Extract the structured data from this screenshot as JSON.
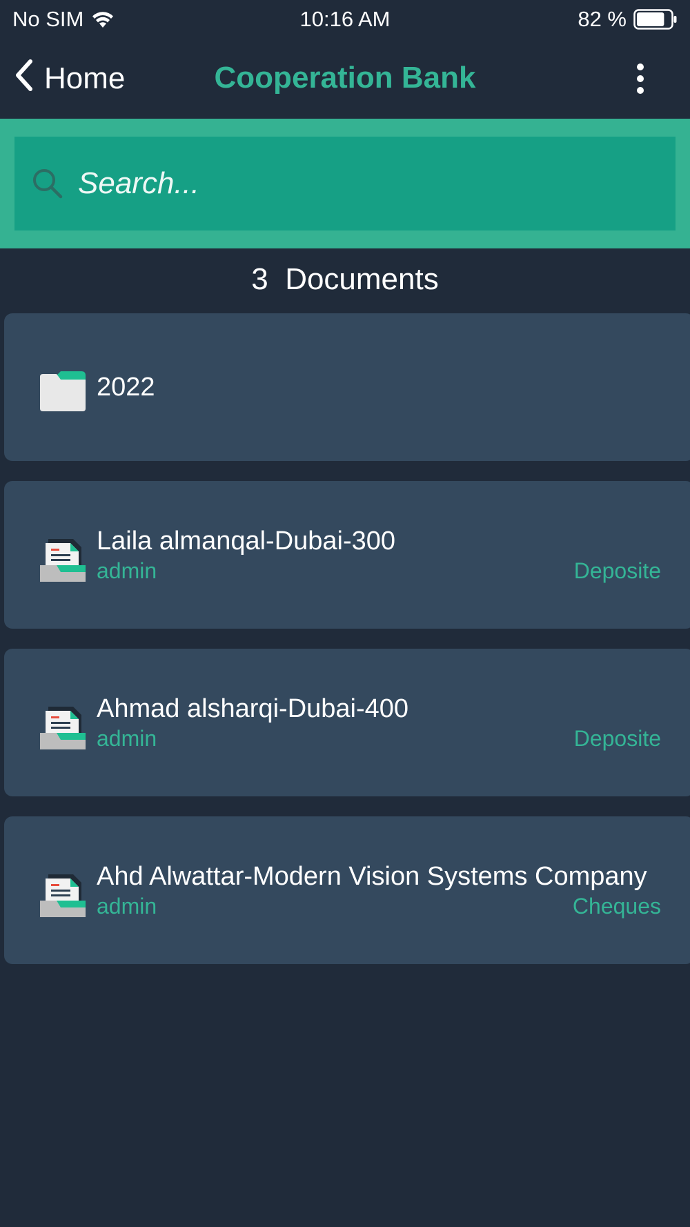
{
  "status_bar": {
    "carrier": "No SIM",
    "time": "10:16 AM",
    "battery": "82 %",
    "battery_level": 0.82
  },
  "nav": {
    "back_label": "Home",
    "title": "Cooperation Bank"
  },
  "search": {
    "placeholder": "Search..."
  },
  "summary": {
    "count": "3",
    "count_label": "Documents"
  },
  "items": [
    {
      "type": "folder",
      "title": "2022"
    },
    {
      "type": "document",
      "title": "Laila almanqal-Dubai-300",
      "owner": "admin",
      "category": "Deposite"
    },
    {
      "type": "document",
      "title": "Ahmad alsharqi-Dubai-400",
      "owner": "admin",
      "category": "Deposite"
    },
    {
      "type": "document",
      "title": "Ahd Alwattar-Modern Vision Systems Company",
      "owner": "admin",
      "category": "Cheques"
    }
  ],
  "colors": {
    "background": "#202b3a",
    "accent": "#34b596",
    "search_band": "#35b292",
    "search_field": "#16a085",
    "card": "#34495e"
  },
  "icons": {
    "back": "chevron-left-icon",
    "more": "more-vertical-icon",
    "search": "search-icon",
    "folder": "folder-icon",
    "document": "document-tray-icon",
    "wifi": "wifi-icon",
    "battery": "battery-icon"
  }
}
